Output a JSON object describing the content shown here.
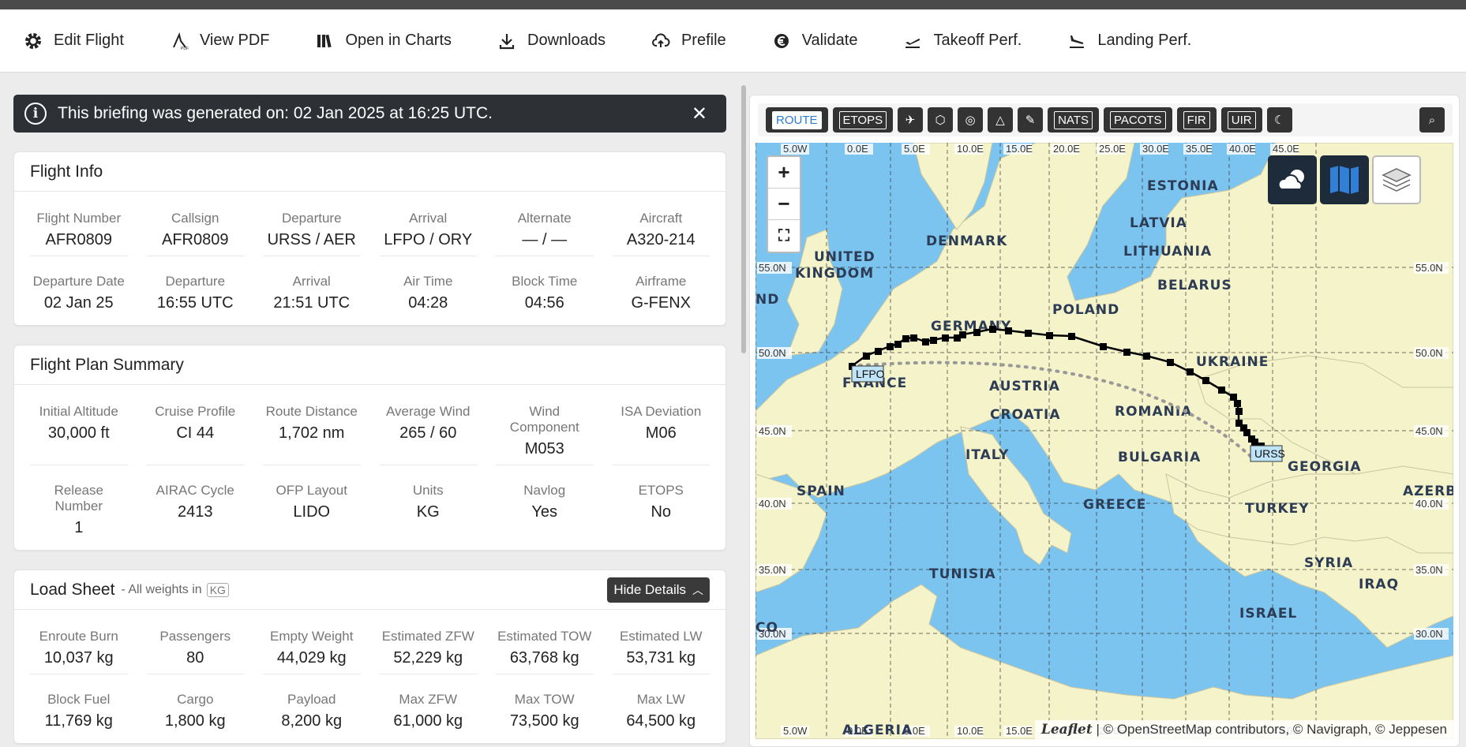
{
  "toolbar": {
    "items": [
      {
        "label": "Edit Flight",
        "icon": "gear-icon"
      },
      {
        "label": "View PDF",
        "icon": "pdf-icon"
      },
      {
        "label": "Open in Charts",
        "icon": "charts-icon"
      },
      {
        "label": "Downloads",
        "icon": "download-icon"
      },
      {
        "label": "Prefile",
        "icon": "cloud-upload-icon"
      },
      {
        "label": "Validate",
        "icon": "validate-icon"
      },
      {
        "label": "Takeoff Perf.",
        "icon": "takeoff-icon"
      },
      {
        "label": "Landing Perf.",
        "icon": "landing-icon"
      }
    ]
  },
  "banner": {
    "message": "This briefing was generated on: 02 Jan 2025 at 16:25 UTC.",
    "close": "✕"
  },
  "flight_info": {
    "title": "Flight Info",
    "row1": [
      {
        "label": "Flight Number",
        "value": "AFR0809"
      },
      {
        "label": "Callsign",
        "value": "AFR0809"
      },
      {
        "label": "Departure",
        "value": "URSS / AER"
      },
      {
        "label": "Arrival",
        "value": "LFPO / ORY"
      },
      {
        "label": "Alternate",
        "value": "— / —"
      },
      {
        "label": "Aircraft",
        "value": "A320-214"
      }
    ],
    "row2": [
      {
        "label": "Departure Date",
        "value": "02 Jan 25"
      },
      {
        "label": "Departure",
        "value": "16:55 UTC"
      },
      {
        "label": "Arrival",
        "value": "21:51 UTC"
      },
      {
        "label": "Air Time",
        "value": "04:28"
      },
      {
        "label": "Block Time",
        "value": "04:56"
      },
      {
        "label": "Airframe",
        "value": "G-FENX"
      }
    ]
  },
  "plan_summary": {
    "title": "Flight Plan Summary",
    "row1": [
      {
        "label": "Initial Altitude",
        "value": "30,000 ft"
      },
      {
        "label": "Cruise Profile",
        "value": "CI 44"
      },
      {
        "label": "Route Distance",
        "value": "1,702 nm"
      },
      {
        "label": "Average Wind",
        "value": "265 / 60"
      },
      {
        "label": "Wind Component",
        "value": "M053"
      },
      {
        "label": "ISA Deviation",
        "value": "M06"
      }
    ],
    "row2": [
      {
        "label": "Release Number",
        "value": "1"
      },
      {
        "label": "AIRAC Cycle",
        "value": "2413"
      },
      {
        "label": "OFP Layout",
        "value": "LIDO"
      },
      {
        "label": "Units",
        "value": "KG"
      },
      {
        "label": "Navlog",
        "value": "Yes"
      },
      {
        "label": "ETOPS",
        "value": "No"
      }
    ]
  },
  "load_sheet": {
    "title": "Load Sheet",
    "subtitle": "- All weights in",
    "unit": "KG",
    "hide_label": "Hide Details",
    "row1": [
      {
        "label": "Enroute Burn",
        "value": "10,037 kg"
      },
      {
        "label": "Passengers",
        "value": "80"
      },
      {
        "label": "Empty Weight",
        "value": "44,029 kg"
      },
      {
        "label": "Estimated ZFW",
        "value": "52,229 kg"
      },
      {
        "label": "Estimated TOW",
        "value": "63,768 kg"
      },
      {
        "label": "Estimated LW",
        "value": "53,731 kg"
      }
    ],
    "row2": [
      {
        "label": "Block Fuel",
        "value": "11,769 kg"
      },
      {
        "label": "Cargo",
        "value": "1,800 kg"
      },
      {
        "label": "Payload",
        "value": "8,200 kg"
      },
      {
        "label": "Max ZFW",
        "value": "61,000 kg"
      },
      {
        "label": "Max TOW",
        "value": "73,500 kg"
      },
      {
        "label": "Max LW",
        "value": "64,500 kg"
      }
    ]
  },
  "map_toolbar": {
    "route": "ROUTE",
    "etops": "ETOPS",
    "nats": "NATS",
    "pacots": "PACOTS",
    "fir": "FIR",
    "uir": "UIR"
  },
  "map": {
    "zoom_in": "+",
    "zoom_out": "−",
    "countries": [
      "ESTONIA",
      "LATVIA",
      "DENMARK",
      "LITHUANIA",
      "UNITED",
      "KINGDOM",
      "BELARUS",
      "POLAND",
      "GERMANY",
      "UKRAINE",
      "FRANCE",
      "AUSTRIA",
      "ROMANIA",
      "CROATIA",
      "ITALY",
      "BULGARIA",
      "GEORGIA",
      "SPAIN",
      "GREECE",
      "TURKEY",
      "AZERBAI",
      "SYRIA",
      "IRAQ",
      "TUNISIA",
      "ISRAEL",
      "ALGERIA",
      "ND",
      "CO"
    ],
    "airports": {
      "departure": "URSS",
      "arrival": "LFPO"
    },
    "lon_labels": [
      "5.0W",
      "0.0E",
      "5.0E",
      "10.0E",
      "15.0E",
      "20.0E",
      "25.0E",
      "30.0E",
      "35.0E",
      "40.0E",
      "45.0E"
    ],
    "lat_labels": [
      "55.0N",
      "50.0N",
      "45.0N",
      "40.0N",
      "35.0N",
      "30.0N"
    ],
    "attribution_leaflet": "Leaflet",
    "attribution": "| © OpenStreetMap contributors, © Navigraph, © Jeppesen"
  },
  "colors": {
    "sea": "#7cc4f0",
    "land": "#f5f3c9",
    "route": "#000000",
    "banner": "#2d3136"
  }
}
